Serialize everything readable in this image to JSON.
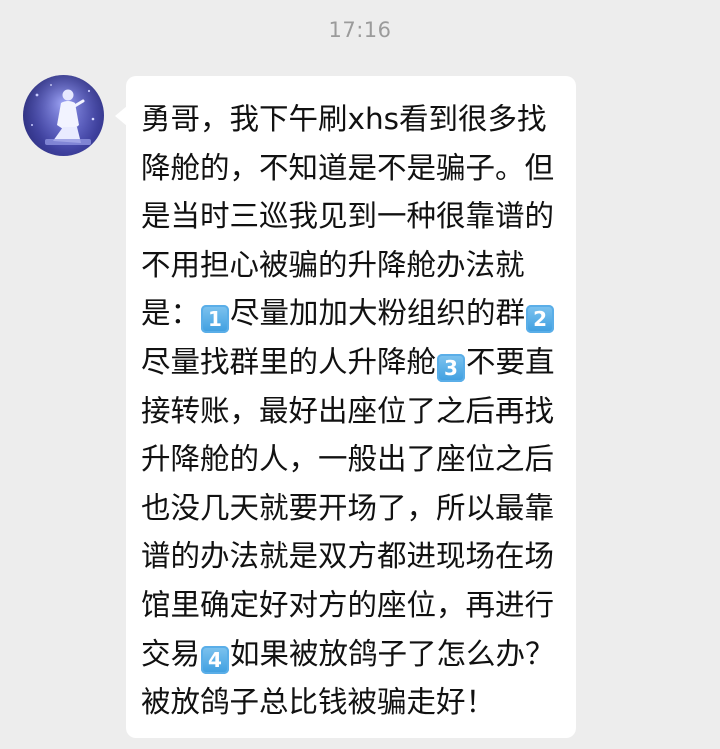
{
  "header": {
    "time": "17:16"
  },
  "chat": {
    "message": {
      "segments": [
        {
          "type": "text",
          "text": "勇哥，我下午刷xhs看到很多找降舱的，不知道是不是骗子。但是当时三巡我见到一种很靠谱的不用担心被骗的升降舱办法就是："
        },
        {
          "type": "keycap",
          "text": "1"
        },
        {
          "type": "text",
          "text": "尽量加加大粉组织的群"
        },
        {
          "type": "keycap",
          "text": "2"
        },
        {
          "type": "text",
          "text": "尽量找群里的人升降舱"
        },
        {
          "type": "keycap",
          "text": "3"
        },
        {
          "type": "text",
          "text": "不要直接转账，最好出座位了之后再找升降舱的人，一般出了座位之后也没几天就要开场了，所以最靠谱的办法就是双方都进现场在场馆里确定好对方的座位，再进行交易"
        },
        {
          "type": "keycap",
          "text": "4"
        },
        {
          "type": "text",
          "text": "如果被放鸽子了怎么办？被放鸽子总比钱被骗走好！"
        }
      ]
    },
    "colors": {
      "background": "#ededed",
      "bubble": "#ffffff",
      "keycap": "#3d9ee0"
    }
  }
}
